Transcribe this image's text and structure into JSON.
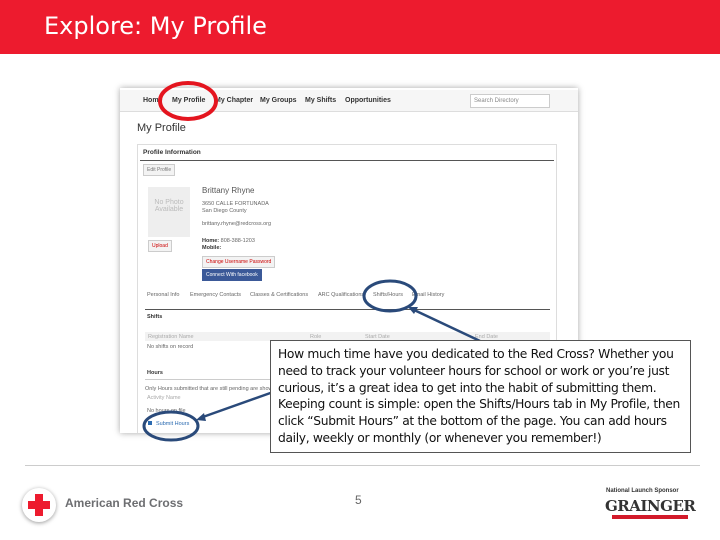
{
  "slide": {
    "title": "Explore: My Profile",
    "page_number": "5"
  },
  "screenshot": {
    "nav": [
      "Home",
      "My Profile",
      "My Chapter",
      "My Groups",
      "My Shifts",
      "Opportunities"
    ],
    "search_placeholder": "Search Directory",
    "heading": "My Profile",
    "panel_title": "Profile Information",
    "edit_button": "Edit Profile",
    "photo_text": "No Photo Available",
    "upload": "Upload",
    "name": "Brittany Rhyne",
    "address1": "3650 CALLE FORTUNADA",
    "address2": "San Diego County",
    "email": "brittany.rhyne@redcross.org",
    "home_label": "Home:",
    "home_phone": "808-388-1203",
    "mobile_label": "Mobile:",
    "change_password": "Change Username Password",
    "facebook": "Connect With facebook",
    "tabs": [
      "Personal Info",
      "Emergency Contacts",
      "Classes & Certifications",
      "ARC Qualifications",
      "Shifts/Hours",
      "Email History"
    ],
    "shifts_heading": "Shifts",
    "shifts_cols": [
      "Registration Name",
      "Role",
      "Start Date",
      "End Date"
    ],
    "no_shifts": "No shifts on record",
    "hours_heading": "Hours",
    "hours_note": "Only Hours submitted that are still pending are shown",
    "activity_col": "Activity Name",
    "no_hours": "No hours on file",
    "submit_hours": "Submit Hours"
  },
  "callout": "How much time have you dedicated to the Red Cross? Whether you need to track your volunteer hours for school or work or you’re just curious, it’s a great idea to get into the habit of submitting them. Keeping count is simple: open the Shifts/Hours tab in My Profile, then click “Submit Hours” at the bottom of the page. You can add hours daily, weekly or monthly (or whenever you remember!)",
  "footer": {
    "org": "American Red Cross",
    "sponsor_label": "National Launch Sponsor",
    "sponsor": "GRAINGER"
  },
  "colors": {
    "red": "#ed1b2e",
    "annotation_blue": "#2a4a7a"
  }
}
